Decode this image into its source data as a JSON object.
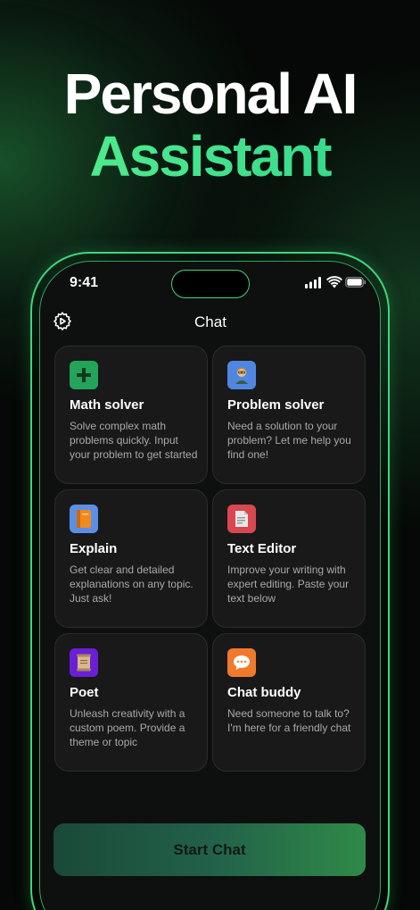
{
  "headline": {
    "line1": "Personal AI",
    "line2": "Assistant"
  },
  "status_bar": {
    "time": "9:41"
  },
  "header": {
    "title": "Chat",
    "settings_icon": "gear-icon"
  },
  "cards": [
    {
      "title": "Math solver",
      "description": "Solve complex math problems quickly. Input your problem to get started",
      "icon": "plus-icon",
      "icon_color": "#24a45b"
    },
    {
      "title": "Problem solver",
      "description": "Need a solution to your problem? Let me help you find one!",
      "icon": "teacher-icon",
      "icon_color": "#4f87e0"
    },
    {
      "title": "Explain",
      "description": "Get clear and detailed explanations on any topic. Just ask!",
      "icon": "book-icon",
      "icon_color": "#5b8fe6"
    },
    {
      "title": "Text Editor",
      "description": "Improve your writing with expert editing. Paste your text below",
      "icon": "document-icon",
      "icon_color": "#d9474f"
    },
    {
      "title": "Poet",
      "description": "Unleash creativity with a custom poem. Provide a theme or topic",
      "icon": "scroll-icon",
      "icon_color": "#6a1fd6"
    },
    {
      "title": "Chat buddy",
      "description": "Need someone to talk to? I'm here for a friendly chat",
      "icon": "speech-bubble-icon",
      "icon_color": "#f07a2c"
    }
  ],
  "start_button": {
    "label": "Start Chat"
  },
  "colors": {
    "accent": "#3ed77a",
    "background": "#050806",
    "card": "#19191a"
  }
}
